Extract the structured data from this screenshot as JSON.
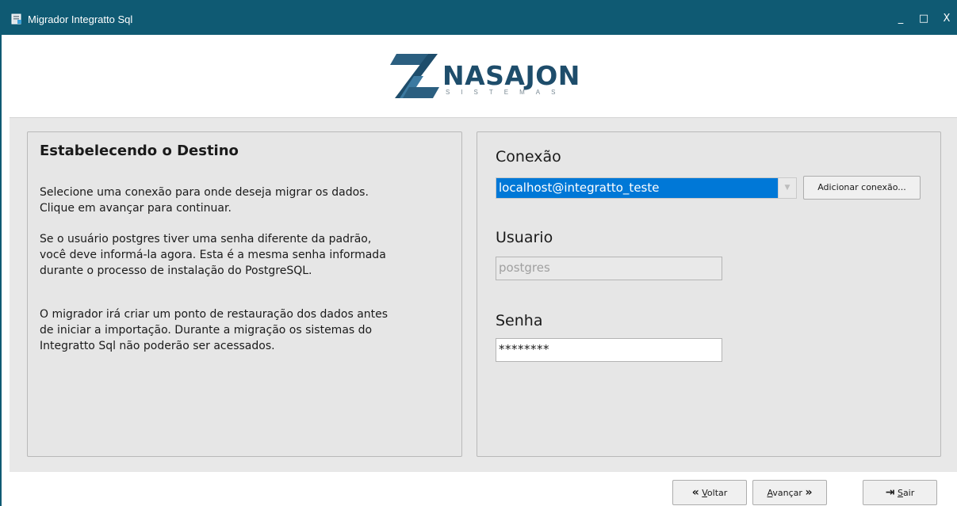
{
  "window": {
    "title": "Migrador Integratto Sql",
    "controls": {
      "minimize": "_",
      "maximize": "□",
      "close": "X"
    }
  },
  "logo": {
    "name": "NASAJON",
    "subtitle": "SISTEMAS"
  },
  "left_panel": {
    "title": "Estabelecendo o Destino",
    "paragraphs": [
      "Selecione uma conexão para onde deseja migrar os dados.\nClique em avançar para continuar.",
      "Se o usuário postgres tiver uma senha diferente da padrão,\nvocê deve informá-la agora. Esta é a mesma senha informada\ndurante o processo de instalação do PostgreSQL.",
      "O migrador irá criar um ponto de restauração dos dados antes\nde iniciar a importação. Durante a migração os sistemas do\nIntegratto Sql não poderão ser acessados."
    ]
  },
  "right_panel": {
    "conexao_label": "Conexão",
    "conexao_value": "localhost@integratto_teste",
    "add_connection_label": "Adicionar conexão...",
    "usuario_label": "Usuario",
    "usuario_value": "postgres",
    "senha_label": "Senha",
    "senha_value": "********"
  },
  "footer": {
    "voltar": {
      "first": "V",
      "rest": "oltar"
    },
    "avancar": {
      "first": "A",
      "rest": "vançar"
    },
    "sair": {
      "first": "S",
      "rest": "air"
    }
  },
  "colors": {
    "titlebar": "#0f5a73",
    "selection": "#0078d7",
    "logo": "#1e4d6b"
  },
  "icons": [
    "app-icon",
    "minimize-icon",
    "maximize-icon",
    "close-icon",
    "dropdown-arrow-icon",
    "double-chevron-left-icon",
    "double-chevron-right-icon",
    "exit-icon",
    "nasajon-logo-mark"
  ]
}
